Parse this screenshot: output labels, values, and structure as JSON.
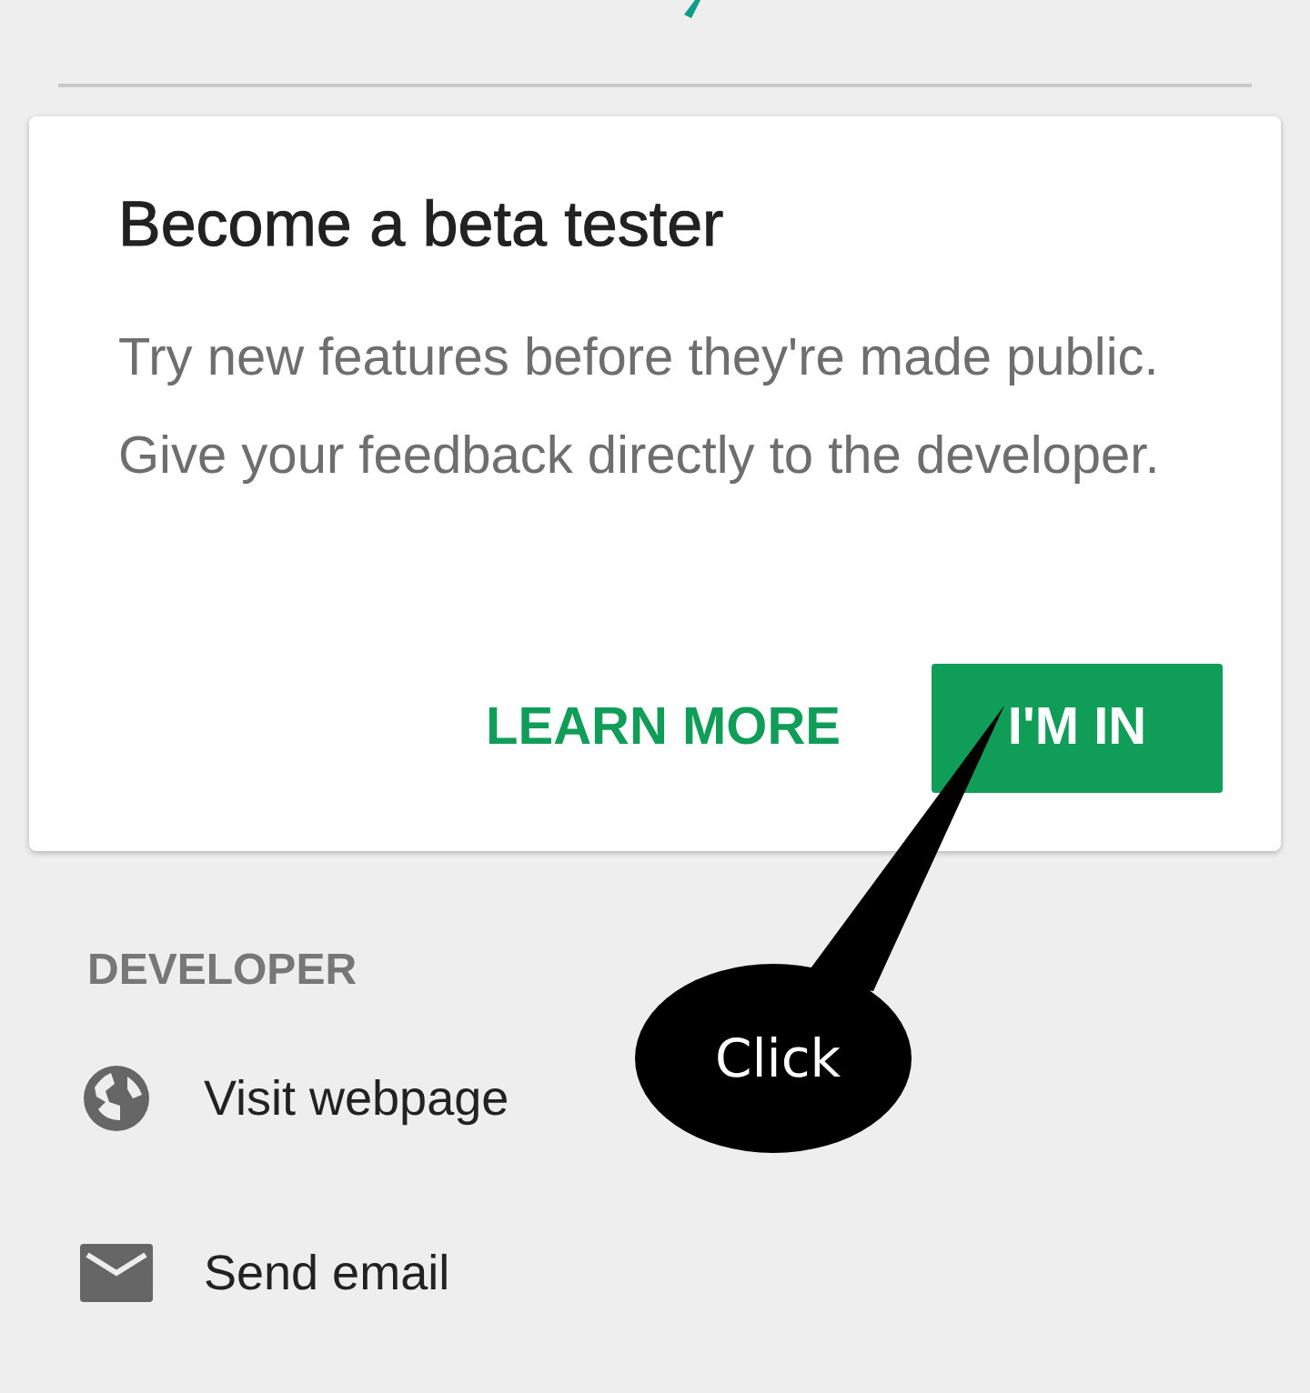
{
  "card": {
    "title": "Become a beta tester",
    "body": "Try new features before they're made public. Give your feedback directly to the developer.",
    "actions": [
      {
        "label": "LEARN MORE",
        "kind": "text"
      },
      {
        "label": "I'M IN",
        "kind": "filled"
      }
    ]
  },
  "developer": {
    "heading": "DEVELOPER",
    "items": [
      {
        "label": "Visit webpage",
        "kind": "globe"
      },
      {
        "label": "Send email",
        "kind": "mail"
      }
    ]
  },
  "callout": {
    "text": "Click"
  }
}
